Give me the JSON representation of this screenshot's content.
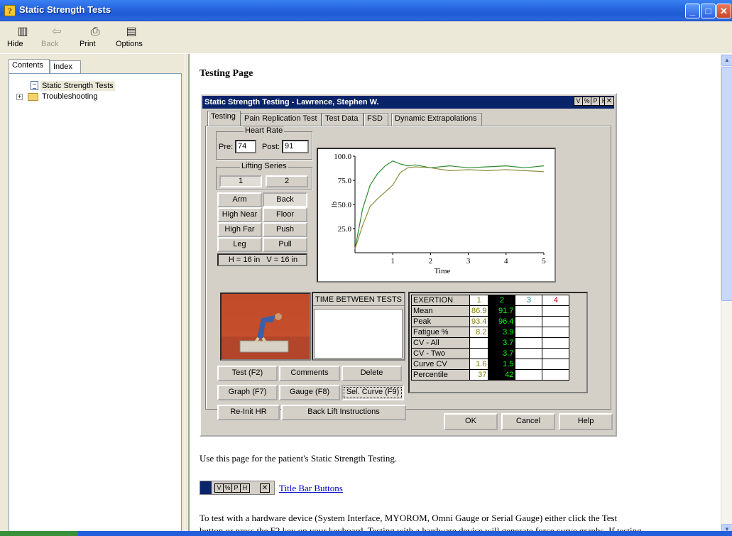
{
  "window": {
    "title": "Static Strength Tests"
  },
  "toolbar": {
    "hide": "Hide",
    "back": "Back",
    "print": "Print",
    "options": "Options"
  },
  "nav": {
    "tabs": [
      "Contents",
      "Index"
    ],
    "tree": [
      {
        "label": "Static Strength Tests",
        "type": "page",
        "selected": true
      },
      {
        "label": "Troubleshooting",
        "type": "folder",
        "expandable": true
      }
    ]
  },
  "content": {
    "heading": "Testing Page",
    "para1": "Use this page for the patient's Static Strength Testing.",
    "title_bar_buttons_link": "Title Bar Buttons",
    "para2_line1": "To test with a hardware device (System Interface, MYOROM, Omni Gauge or Serial Gauge) either click the Test",
    "para2_line2": "button or press the F2 key on your keyboard. Testing with a hardware device will generate force curve graphs. If testing",
    "buttons_strip": [
      "V",
      "%",
      "P",
      "H"
    ]
  },
  "dialog": {
    "title": "Static Strength Testing - Lawrence, Stephen W.",
    "titlebar_buttons": [
      "V",
      "%",
      "P",
      "H"
    ],
    "tabs": [
      "Testing",
      "Pain Replication Test",
      "Test Data",
      "FSD",
      "Dynamic Extrapolations"
    ],
    "heart_rate": {
      "label": "Heart Rate",
      "pre_label": "Pre:",
      "pre_value": "74",
      "post_label": "Post:",
      "post_value": "91"
    },
    "lifting_series": {
      "label": "Lifting Series",
      "options": [
        "1",
        "2"
      ]
    },
    "lift_buttons": [
      "Arm",
      "Back",
      "High Near",
      "Floor",
      "High Far",
      "Push",
      "Leg",
      "Pull"
    ],
    "position": "H = 16 in   V = 16 in",
    "time_between_tests": "TIME BETWEEN TESTS",
    "action_buttons": [
      "Test  (F2)",
      "Comments",
      "Delete",
      "Graph  (F7)",
      "Gauge  (F8)",
      "Sel. Curve  (F9)",
      "Re-Init HR",
      "Back Lift Instructions"
    ],
    "stats": {
      "headers": [
        "EXERTION",
        "1",
        "2",
        "3",
        "4"
      ],
      "rows": [
        {
          "label": "Mean",
          "v1": "86.9",
          "v2": "91.7"
        },
        {
          "label": "Peak",
          "v1": "93.4",
          "v2": "96.4"
        },
        {
          "label": "Fatigue %",
          "v1": "8.2",
          "v2": "3.9"
        },
        {
          "label": "CV - All",
          "v1": "",
          "v2": "3.7"
        },
        {
          "label": "CV - Two",
          "v1": "",
          "v2": "3.7"
        },
        {
          "label": "Curve CV",
          "v1": "1.6",
          "v2": "1.5"
        },
        {
          "label": "Percentile",
          "v1": "37",
          "v2": "42"
        }
      ]
    },
    "footer": {
      "ok": "OK",
      "cancel": "Cancel",
      "help": "Help"
    }
  },
  "chart_data": {
    "type": "line",
    "xlabel": "Time",
    "ylabel": "lb",
    "xlim": [
      0,
      5
    ],
    "ylim": [
      0,
      100
    ],
    "x_ticks": [
      "1",
      "2",
      "3",
      "4",
      "5"
    ],
    "y_ticks": [
      "25.0",
      "50.0",
      "75.0",
      "100.0"
    ],
    "series": [
      {
        "color": "#2E8B2E",
        "x": [
          0,
          0.2,
          0.4,
          0.6,
          0.8,
          1.0,
          1.2,
          1.4,
          1.6,
          2.0,
          2.5,
          3.0,
          3.5,
          4.0,
          4.5,
          5.0
        ],
        "y": [
          4,
          45,
          70,
          82,
          90,
          95,
          92,
          90,
          91,
          88,
          90,
          88,
          89,
          90,
          88,
          90
        ]
      },
      {
        "color": "#8C8C3C",
        "x": [
          0,
          0.2,
          0.4,
          0.6,
          0.8,
          1.0,
          1.2,
          1.4,
          1.6,
          2.0,
          2.5,
          3.0,
          3.5,
          4.0,
          4.5,
          5.0
        ],
        "y": [
          4,
          28,
          48,
          56,
          63,
          70,
          83,
          88,
          89,
          88,
          85,
          86,
          85,
          86,
          85,
          84
        ]
      }
    ]
  }
}
